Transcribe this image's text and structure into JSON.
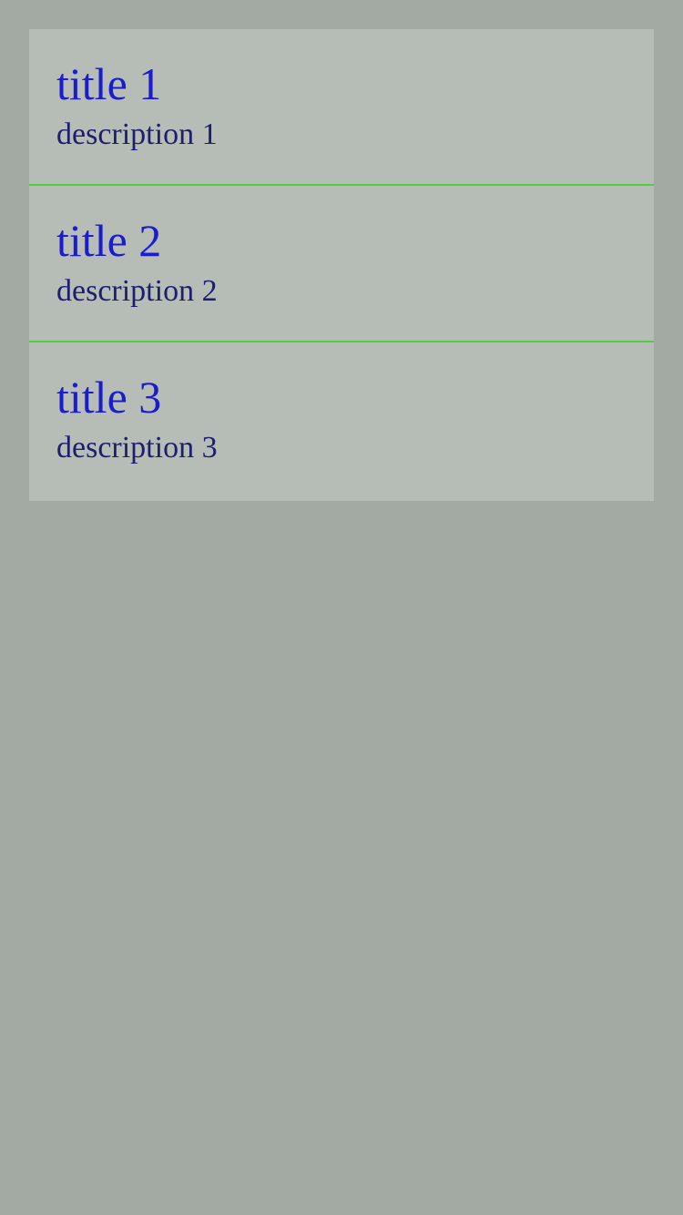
{
  "list": {
    "items": [
      {
        "title": "title 1",
        "description": "description 1"
      },
      {
        "title": "title 2",
        "description": "description 2"
      },
      {
        "title": "title 3",
        "description": "description 3"
      }
    ]
  },
  "colors": {
    "page_background": "#a3aaa3",
    "list_background": "#b6bdb6",
    "divider": "#4fcf3a",
    "title_text": "#1c1ccf",
    "description_text": "#1e1e6e"
  }
}
